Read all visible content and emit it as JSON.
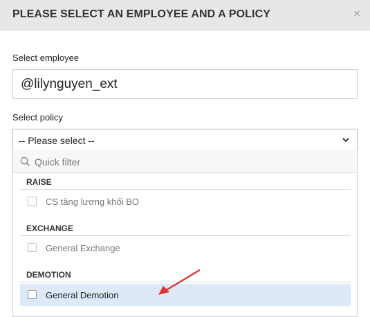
{
  "modal": {
    "title": "PLEASE SELECT AN EMPLOYEE AND A POLICY",
    "close_glyph": "×"
  },
  "employee": {
    "label": "Select employee",
    "value": "@lilynguyen_ext"
  },
  "policy": {
    "label": "Select policy",
    "selected": "-- Please select --",
    "filter_placeholder": "Quick filter",
    "groups": [
      {
        "name": "RAISE",
        "options": [
          {
            "label": "CS tăng lương khối BO",
            "checked": false,
            "highlighted": false
          }
        ]
      },
      {
        "name": "EXCHANGE",
        "options": [
          {
            "label": "General Exchange",
            "checked": false,
            "highlighted": false
          }
        ]
      },
      {
        "name": "DEMOTION",
        "options": [
          {
            "label": "General Demotion",
            "checked": false,
            "highlighted": true
          }
        ]
      }
    ]
  },
  "annotation": {
    "arrow_color": "#e03530"
  },
  "colors": {
    "header_bg": "#e7e7e7",
    "highlight_bg": "#dde9f7",
    "status_green": "#33a853"
  }
}
